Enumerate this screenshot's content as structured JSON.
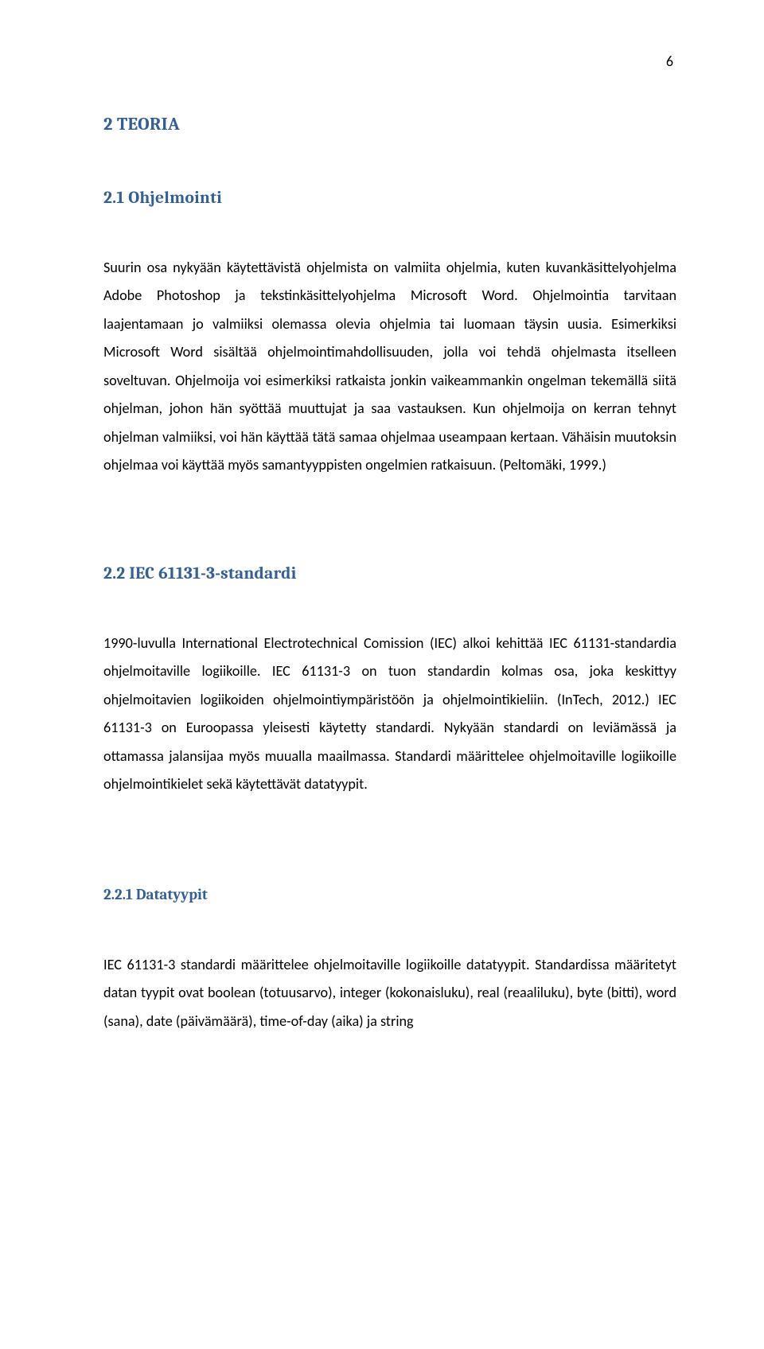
{
  "page_number": "6",
  "sections": [
    {
      "heading_level": "h1",
      "heading": "2    TEORIA",
      "paragraphs": []
    },
    {
      "heading_level": "h2",
      "heading": "2.1   Ohjelmointi",
      "paragraphs": [
        "Suurin osa nykyään käytettävistä ohjelmista on valmiita ohjelmia, kuten kuvankäsittelyohjelma Adobe Photoshop ja tekstinkäsittelyohjelma Microsoft Word. Ohjelmointia tarvitaan laajentamaan jo valmiiksi olemassa olevia ohjelmia tai luomaan täysin uusia. Esimerkiksi Microsoft Word sisältää ohjelmointimahdollisuuden, jolla voi tehdä ohjelmasta itselleen soveltuvan. Ohjelmoija voi esimerkiksi ratkaista jonkin vaikeammankin ongelman tekemällä siitä ohjelman, johon hän syöttää muuttujat ja saa vastauksen. Kun ohjelmoija on kerran tehnyt ohjelman valmiiksi, voi hän käyttää tätä samaa ohjelmaa useampaan kertaan. Vähäisin muutoksin ohjelmaa voi käyttää myös samantyyppisten ongelmien ratkaisuun. (Peltomäki, 1999.)"
      ]
    },
    {
      "heading_level": "h2",
      "heading": "2.2   IEC 61131-3-standardi",
      "paragraphs": [
        "1990-luvulla International Electrotechnical Comission (IEC) alkoi kehittää IEC 61131-standardia ohjelmoitaville logiikoille. IEC 61131-3 on tuon standardin kolmas osa, joka keskittyy ohjelmoitavien logiikoiden ohjelmointiympäristöön ja ohjelmointikieliin. (InTech, 2012.) IEC 61131-3 on Euroopassa yleisesti käytetty standardi. Nykyään standardi on leviämässä ja ottamassa jalansijaa myös muualla maailmassa. Standardi määrittelee ohjelmoitaville logiikoille ohjelmointikielet sekä käytettävät datatyypit."
      ]
    },
    {
      "heading_level": "h3",
      "heading": "2.2.1  Datatyypit",
      "paragraphs": [
        "IEC 61131-3 standardi määrittelee ohjelmoitaville logiikoille datatyypit. Standardissa määritetyt datan tyypit ovat boolean (totuusarvo), integer (kokonaisluku), real (reaaliluku), byte (bitti), word (sana), date (päivämäärä), time-of-day (aika) ja string"
      ]
    }
  ]
}
